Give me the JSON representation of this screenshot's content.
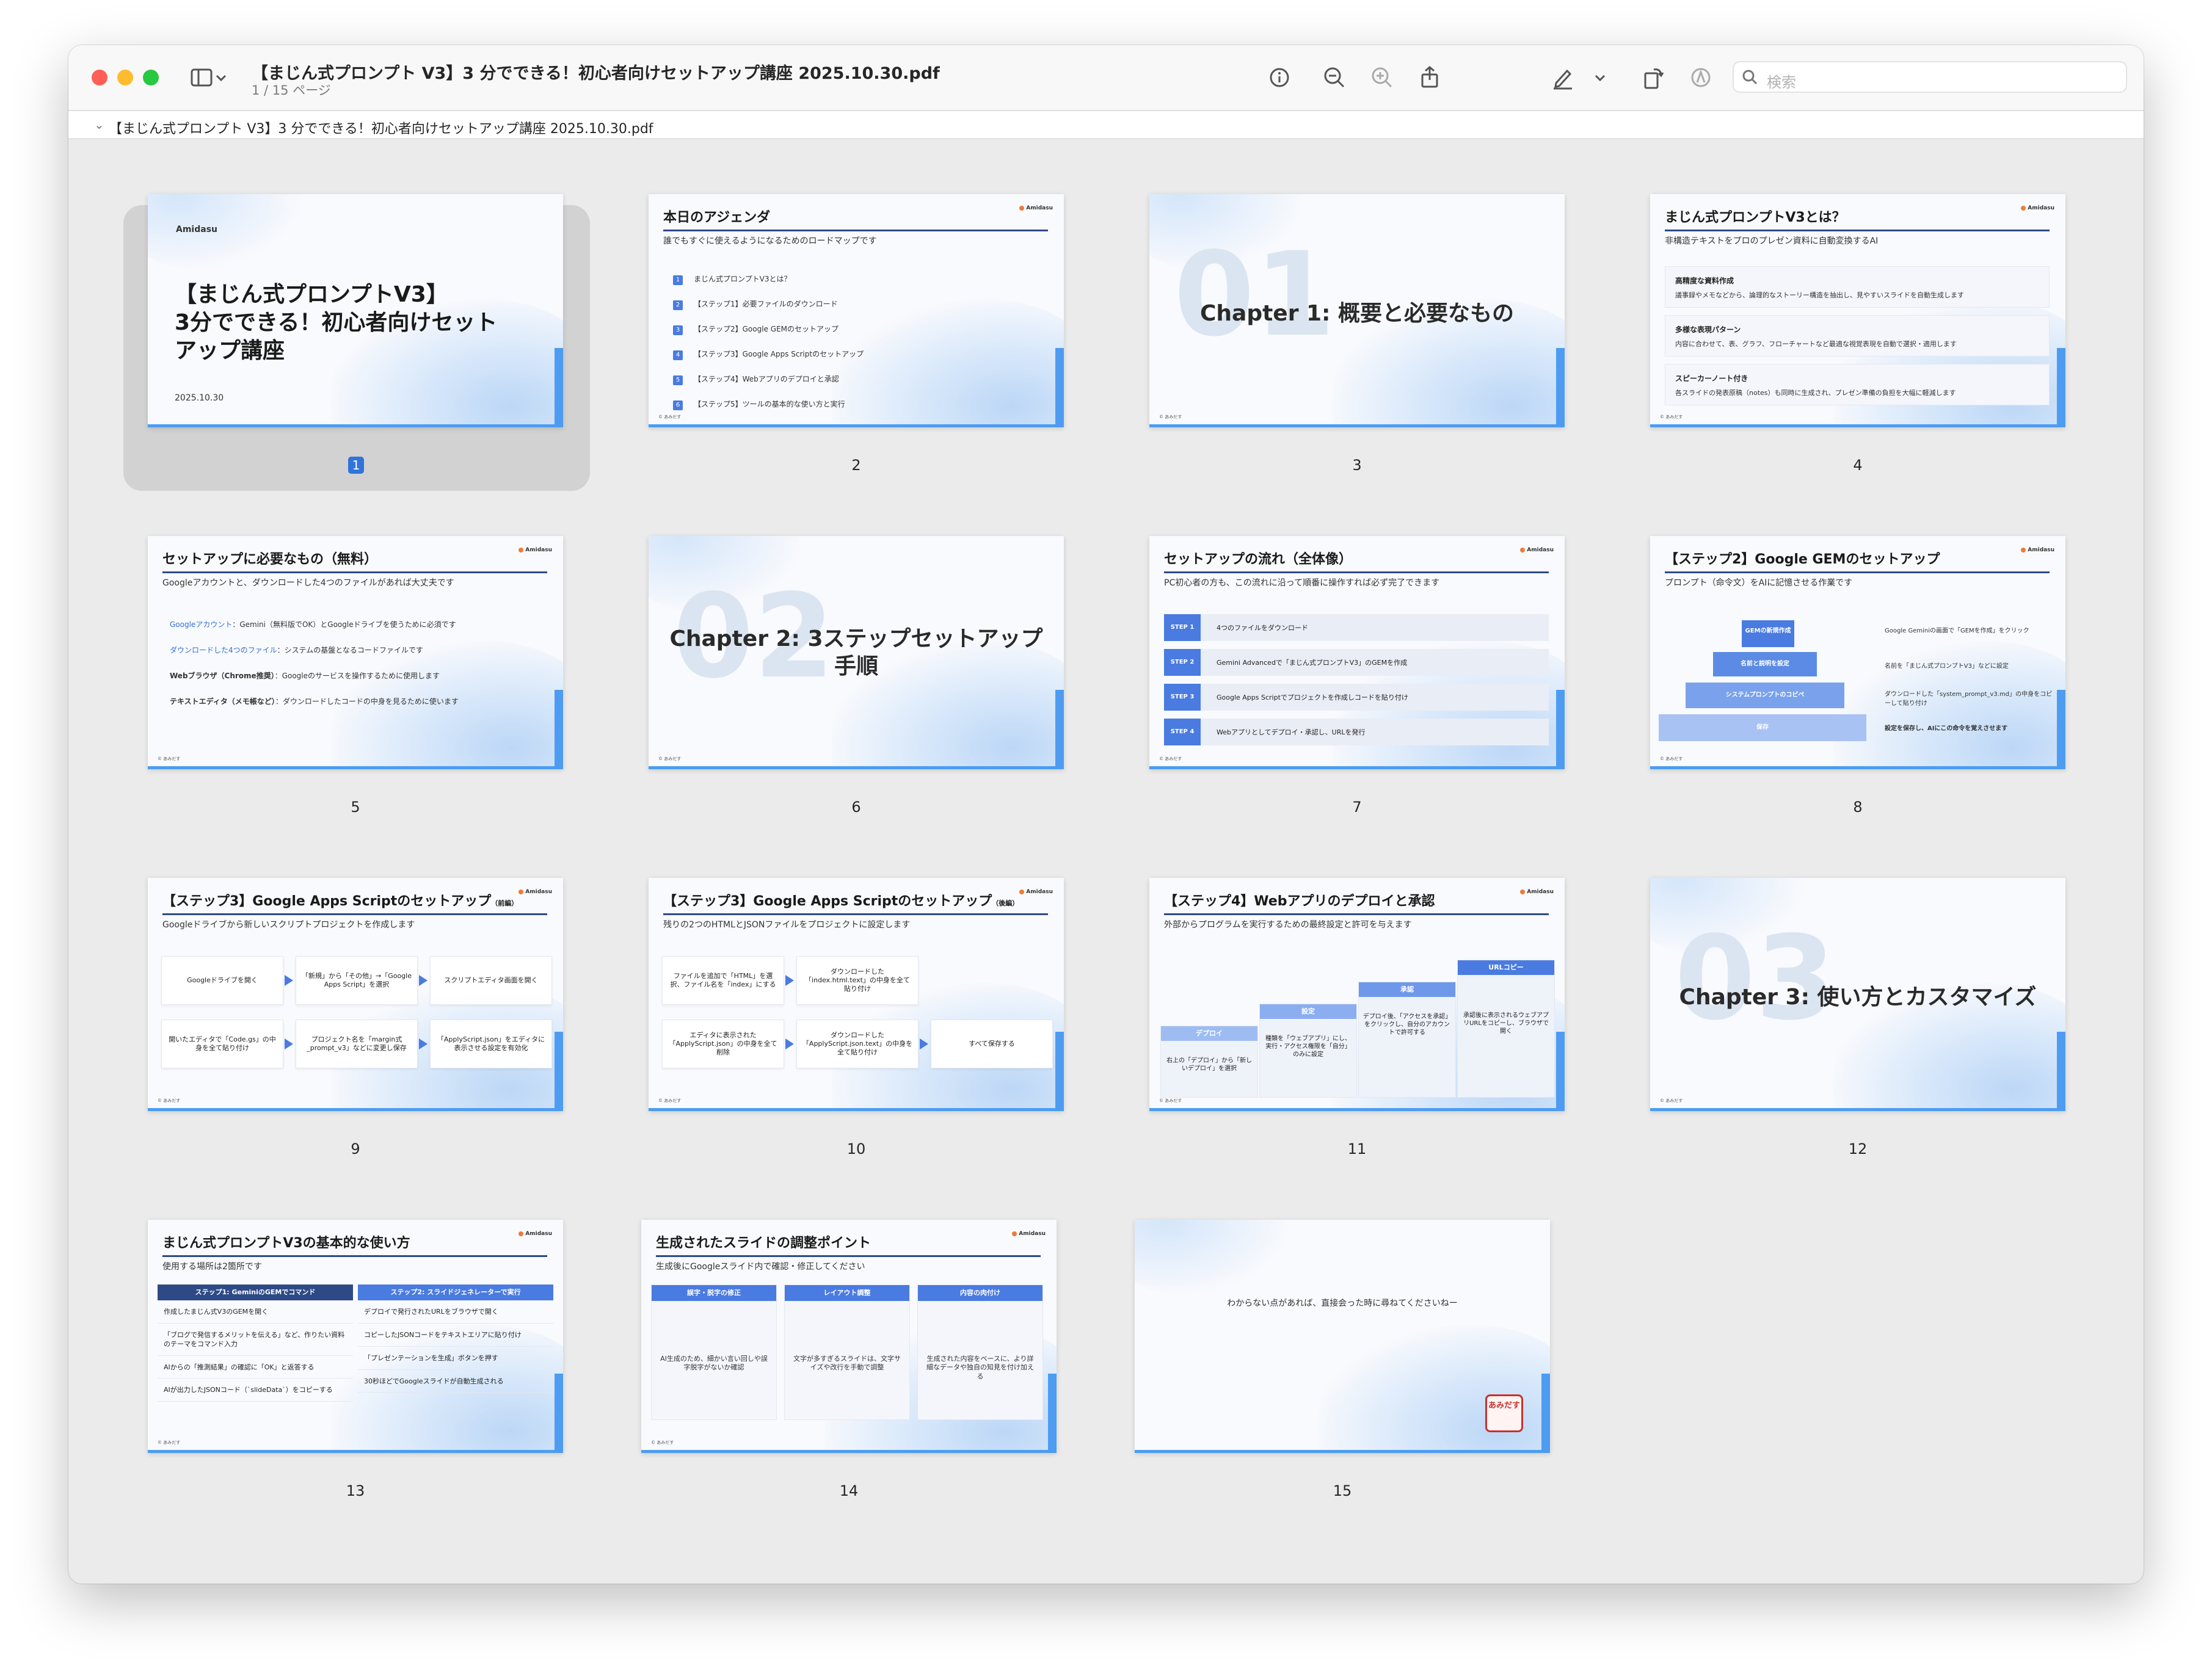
{
  "window": {
    "title": "【まじん式プロンプト V3】3 分でできる！初心者向けセットアップ講座 2025.10.30.pdf",
    "page_indicator": "1 / 15 ページ",
    "search_placeholder": "検索",
    "path_label": "【まじん式プロンプト V3】3 分でできる！初心者向けセットアップ講座 2025.10.30.pdf"
  },
  "selected_page": 1,
  "slides": {
    "s1": {
      "logo": "Amidasu",
      "title": "【まじん式プロンプトV3】\n3分でできる！初心者向けセット\nアップ講座",
      "date": "2025.10.30",
      "number": "1"
    },
    "s2": {
      "title": "本日のアジェンダ",
      "subtitle": "誰でもすぐに使えるようになるためのロードマップです",
      "items": [
        "まじん式プロンプトV3とは？",
        "【ステップ1】必要ファイルのダウンロード",
        "【ステップ2】Google GEMのセットアップ",
        "【ステップ3】Google Apps Scriptのセットアップ",
        "【ステップ4】Webアプリのデプロイと承認",
        "【ステップ5】ツールの基本的な使い方と実行"
      ],
      "nums": [
        "1",
        "2",
        "3",
        "4",
        "5",
        "6"
      ],
      "number": "2"
    },
    "s3": {
      "big": "01",
      "title": "Chapter 1: 概要と必要なもの",
      "number": "3"
    },
    "s4": {
      "title": "まじん式プロンプトV3とは？",
      "subtitle": "非構造テキストをプロのプレゼン資料に自動変換するAI",
      "cards": [
        {
          "h": "高精度な資料作成",
          "d": "議事録やメモなどから、論理的なストーリー構造を抽出し、見やすいスライドを自動生成します"
        },
        {
          "h": "多様な表現パターン",
          "d": "内容に合わせて、表、グラフ、フローチャートなど最適な視覚表現を自動で選択・適用します"
        },
        {
          "h": "スピーカーノート付き",
          "d": "各スライドの発表原稿（notes）も同時に生成され、プレゼン準備の負担を大幅に軽減します"
        }
      ],
      "number": "4"
    },
    "s5": {
      "title": "セットアップに必要なもの（無料）",
      "subtitle": "Googleアカウントと、ダウンロードした4つのファイルがあれば大丈夫です",
      "rows": [
        {
          "k": "Googleアカウント",
          "v": "：Gemini（無料版でOK）とGoogleドライブを使うために必須です"
        },
        {
          "k": "ダウンロードした4つのファイル",
          "v": "：システムの基盤となるコードファイルです"
        },
        {
          "k": "Webブラウザ（Chrome推奨）",
          "v": "：Googleのサービスを操作するために使用します"
        },
        {
          "k": "テキストエディタ（メモ帳など）",
          "v": "：ダウンロードしたコードの中身を見るために使います"
        }
      ],
      "number": "5"
    },
    "s6": {
      "big": "02",
      "title": "Chapter 2: 3ステップセットアップ\n手順",
      "number": "6"
    },
    "s7": {
      "title": "セットアップの流れ（全体像）",
      "subtitle": "PC初心者の方も、この流れに沿って順番に操作すれば必ず完了できます",
      "steps": [
        {
          "tag": "STEP 1",
          "t": "4つのファイルをダウンロード"
        },
        {
          "tag": "STEP 2",
          "t": "Gemini Advancedで「まじん式プロンプトV3」のGEMを作成"
        },
        {
          "tag": "STEP 3",
          "t": "Google Apps Scriptでプロジェクトを作成しコードを貼り付け"
        },
        {
          "tag": "STEP 4",
          "t": "Webアプリとしてデプロイ・承認し、URLを発行"
        }
      ],
      "number": "7"
    },
    "s8": {
      "title": "【ステップ2】Google GEMのセットアップ",
      "subtitle": "プロンプト（命令文）をAIに記憶させる作業です",
      "levels": [
        "GEMの新規作成",
        "名前と説明を設定",
        "システムプロンプトのコピペ",
        "保存"
      ],
      "notes": [
        "Google Geminiの画面で「GEMを作成」をクリック",
        "名前を「まじん式プロンプトV3」などに設定",
        "ダウンロードした「system_prompt_v3.md」の中身をコピーして貼り付け",
        "設定を保存し、AIにこの命令を覚えさせます"
      ],
      "number": "8"
    },
    "s9": {
      "title": "【ステップ3】Google Apps Scriptのセットアップ",
      "tag": "（前編）",
      "subtitle": "Googleドライブから新しいスクリプトプロジェクトを作成します",
      "boxes": [
        "Googleドライブを開く",
        "「新規」から「その他」→「Google Apps Script」を選択",
        "スクリプトエディタ画面を開く",
        "開いたエディタで「Code.gs」の中身を全て貼り付け",
        "プロジェクト名を「margin式_prompt_v3」などに変更し保存",
        "「ApplyScript.json」をエディタに表示させる設定を有効化"
      ],
      "number": "9"
    },
    "s10": {
      "title": "【ステップ3】Google Apps Scriptのセットアップ",
      "tag": "（後編）",
      "subtitle": "残りの2つのHTMLとJSONファイルをプロジェクトに設定します",
      "boxes": [
        "ファイルを追加で「HTML」を選択、ファイル名を「index」にする",
        "ダウンロードした「index.html.text」の中身を全て貼り付け",
        "エディタに表示された「ApplyScript.json」の中身を全て削除",
        "ダウンロードした「ApplyScript.json.text」の中身を全て貼り付け",
        "すべて保存する"
      ],
      "number": "10"
    },
    "s11": {
      "title": "【ステップ4】Webアプリのデプロイと承認",
      "subtitle": "外部からプログラムを実行するための最終設定と許可を与えます",
      "stairs": [
        {
          "h": "デプロイ",
          "d": "右上の「デプロイ」から「新しいデプロイ」を選択"
        },
        {
          "h": "設定",
          "d": "種類を「ウェブアプリ」にし、実行・アクセス権限を「自分」のみに設定"
        },
        {
          "h": "承認",
          "d": "デプロイ後、「アクセスを承認」をクリックし、自分のアカウントで許可する"
        },
        {
          "h": "URLコピー",
          "d": "承認後に表示されるウェブアプリURLをコピーし、ブラウザで開く"
        }
      ],
      "number": "11"
    },
    "s12": {
      "big": "03",
      "title": "Chapter 3: 使い方とカスタマイズ",
      "number": "12"
    },
    "s13": {
      "title": "まじん式プロンプトV3の基本的な使い方",
      "subtitle": "使用する場所は2箇所です",
      "left_h": "ステップ1: GeminiのGEMでコマンド",
      "left": [
        "作成したまじん式V3のGEMを開く",
        "「ブログで発信するメリットを伝える」など、作りたい資料のテーマをコマンド入力",
        "AIからの「推測結果」の確認に「OK」と返答する",
        "AIが出力したJSONコード（`slideData`）をコピーする"
      ],
      "right_h": "ステップ2: スライドジェネレーターで実行",
      "right": [
        "デプロイで発行されたURLをブラウザで開く",
        "コピーしたJSONコードをテキストエリアに貼り付け",
        "「プレゼンテーションを生成」ボタンを押す",
        "30秒ほどでGoogleスライドが自動生成される"
      ],
      "number": "13"
    },
    "s14": {
      "title": "生成されたスライドの調整ポイント",
      "subtitle": "生成後にGoogleスライド内で確認・修正してください",
      "cols": [
        {
          "h": "誤字・脱字の修正",
          "d": "AI生成のため、細かい言い回しや誤字脱字がないか確認"
        },
        {
          "h": "レイアウト調整",
          "d": "文字が多すぎるスライドは、文字サイズや改行を手動で調整"
        },
        {
          "h": "内容の肉付け",
          "d": "生成された内容をベースに、より詳細なデータや独自の知見を付け加える"
        }
      ],
      "number": "14"
    },
    "s15": {
      "text": "わからない点があれば、直接会った時に尋ねてくださいねー",
      "stamp": "あみだす",
      "number": "15"
    },
    "footer": "© あみだす"
  },
  "colors": {
    "accent": "#4a7be0",
    "selection": "#2f73db",
    "close": "#fe5f57",
    "minimize": "#febc2e",
    "zoom": "#28c840"
  }
}
